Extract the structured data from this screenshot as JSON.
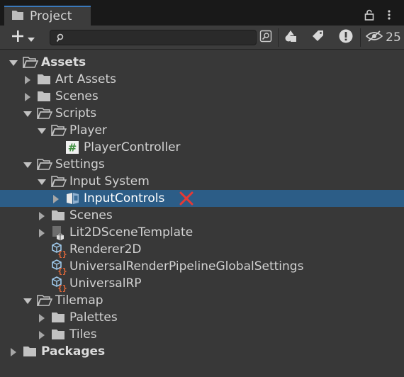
{
  "window": {
    "tab_title": "Project",
    "hidden_count": "25",
    "icons": {
      "tab": "folder-icon",
      "lock": "lock-icon",
      "menu": "more-vert-icon"
    }
  },
  "toolbar": {
    "search_placeholder": "",
    "search_value": "",
    "icons": [
      "add-icon",
      "dropdown-caret-icon",
      "search-icon",
      "scene-search-icon",
      "type-filter-icon",
      "label-filter-icon",
      "error-filter-icon",
      "hidden-packages-icon"
    ]
  },
  "tree": {
    "rows": [
      {
        "label": "Assets",
        "bold": true,
        "depth": 0,
        "arrow": "expanded",
        "icon": "open-folder-icon"
      },
      {
        "label": "Art Assets",
        "depth": 1,
        "arrow": "collapsed",
        "icon": "folder-icon"
      },
      {
        "label": "Scenes",
        "depth": 1,
        "arrow": "collapsed",
        "icon": "folder-icon"
      },
      {
        "label": "Scripts",
        "depth": 1,
        "arrow": "expanded",
        "icon": "open-folder-icon"
      },
      {
        "label": "Player",
        "depth": 2,
        "arrow": "expanded",
        "icon": "open-folder-icon"
      },
      {
        "label": "PlayerController",
        "depth": 3,
        "arrow": "none",
        "icon": "csharp-script-icon"
      },
      {
        "label": "Settings",
        "depth": 1,
        "arrow": "expanded",
        "icon": "open-folder-icon"
      },
      {
        "label": "Input System",
        "depth": 2,
        "arrow": "expanded",
        "icon": "open-folder-icon"
      },
      {
        "label": "InputControls",
        "depth": 3,
        "arrow": "collapsed",
        "icon": "input-actions-icon",
        "selected": true,
        "marker": "red-x-icon"
      },
      {
        "label": "Scenes",
        "depth": 2,
        "arrow": "collapsed",
        "icon": "folder-icon"
      },
      {
        "label": "Lit2DSceneTemplate",
        "depth": 2,
        "arrow": "collapsed",
        "icon": "scene-template-icon"
      },
      {
        "label": "Renderer2D",
        "depth": 2,
        "arrow": "none",
        "icon": "scriptable-object-icon"
      },
      {
        "label": "UniversalRenderPipelineGlobalSettings",
        "depth": 2,
        "arrow": "none",
        "icon": "scriptable-object-icon"
      },
      {
        "label": "UniversalRP",
        "depth": 2,
        "arrow": "none",
        "icon": "scriptable-object-icon"
      },
      {
        "label": "Tilemap",
        "depth": 1,
        "arrow": "expanded",
        "icon": "open-folder-icon"
      },
      {
        "label": "Palettes",
        "depth": 2,
        "arrow": "collapsed",
        "icon": "folder-icon"
      },
      {
        "label": "Tiles",
        "depth": 2,
        "arrow": "collapsed",
        "icon": "folder-icon"
      },
      {
        "label": "Packages",
        "bold": true,
        "depth": 0,
        "arrow": "collapsed",
        "icon": "folder-icon"
      }
    ]
  },
  "colors": {
    "background": "#383838",
    "selection": "#2c5d87",
    "tab_accent": "#3a79bb",
    "marker": "#e53935"
  }
}
